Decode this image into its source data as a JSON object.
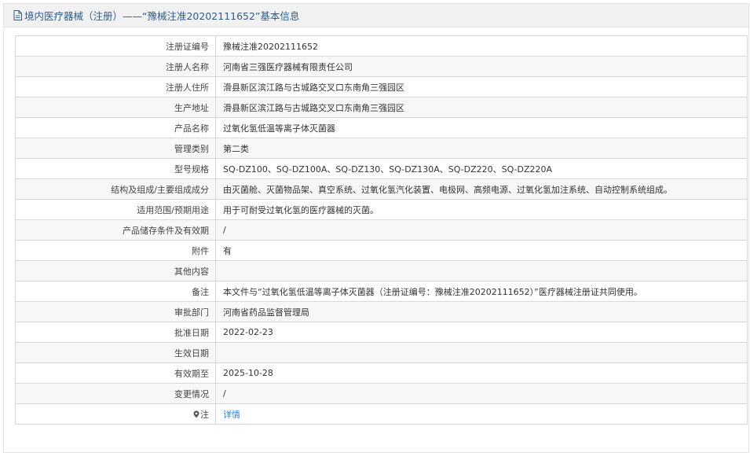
{
  "header": {
    "title": "境内医疗器械（注册）——“豫械注准20202111652”基本信息"
  },
  "rows": [
    {
      "label": "注册证编号",
      "value": "豫械注准20202111652"
    },
    {
      "label": "注册人名称",
      "value": "河南省三强医疗器械有限责任公司"
    },
    {
      "label": "注册人住所",
      "value": "滑县新区滨江路与古城路交叉口东南角三强园区"
    },
    {
      "label": "生产地址",
      "value": "滑县新区滨江路与古城路交叉口东南角三强园区"
    },
    {
      "label": "产品名称",
      "value": "过氧化氢低温等离子体灭菌器"
    },
    {
      "label": "管理类别",
      "value": "第二类"
    },
    {
      "label": "型号规格",
      "value": "SQ-DZ100、SQ-DZ100A、SQ-DZ130、SQ-DZ130A、SQ-DZ220、SQ-DZ220A"
    },
    {
      "label": "结构及组成/主要组成成分",
      "value": "由灭菌舱、灭菌物品架、真空系统、过氧化氢汽化装置、电极网、高频电源、过氧化氢加注系统、自动控制系统组成。"
    },
    {
      "label": "适用范围/预期用途",
      "value": "用于可耐受过氧化氢的医疗器械的灭菌。"
    },
    {
      "label": "产品储存条件及有效期",
      "value": "/"
    },
    {
      "label": "附件",
      "value": "有"
    },
    {
      "label": "其他内容",
      "value": ""
    },
    {
      "label": "备注",
      "value": "本文件与“过氧化氢低温等离子体灭菌器（注册证编号：豫械注准20202111652）”医疗器械注册证共同使用。"
    },
    {
      "label": "审批部门",
      "value": "河南省药品监督管理局"
    },
    {
      "label": "批准日期",
      "value": "2022-02-23"
    },
    {
      "label": "生效日期",
      "value": ""
    },
    {
      "label": "有效期至",
      "value": "2025-10-28"
    },
    {
      "label": "变更情况",
      "value": "/"
    }
  ],
  "note_row": {
    "label": "注",
    "link_text": "详情"
  },
  "colors": {
    "header_text": "#2c5d8f",
    "link": "#2f7fd1",
    "border": "#d8d8d8"
  }
}
